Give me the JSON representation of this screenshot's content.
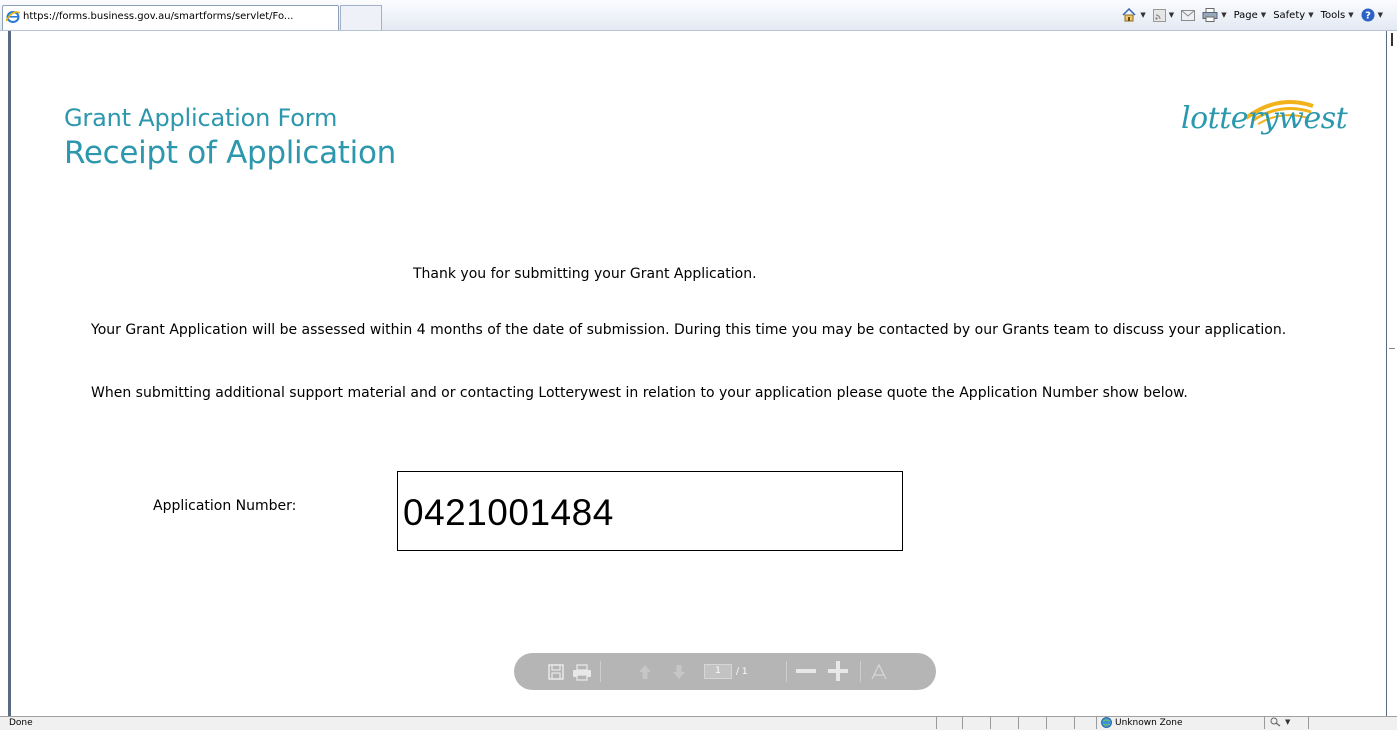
{
  "browser": {
    "tab_title": "https://forms.business.gov.au/smartforms/servlet/Fo...",
    "commands": {
      "page": "Page",
      "safety": "Safety",
      "tools": "Tools"
    }
  },
  "page": {
    "form_title": "Grant Application Form",
    "page_title": "Receipt of Application",
    "logo_text": "lotterywest",
    "thanks": "Thank you for submitting your Grant Application.",
    "paragraph1": "Your Grant Application will be assessed within 4 months of the date of submission. During this time you may be contacted by our Grants team to discuss your application.",
    "paragraph2": "When submitting additional support material and or contacting Lotterywest in relation to your application please quote the Application Number show below.",
    "app_number_label": "Application Number:",
    "app_number_value": "0421001484"
  },
  "pdf_toolbar": {
    "current_page": "1",
    "total_pages": "/ 1"
  },
  "statusbar": {
    "status": "Done",
    "zone": "Unknown Zone"
  },
  "colors": {
    "accent": "#2c97ad",
    "logo_arc": "#f2b21b"
  }
}
